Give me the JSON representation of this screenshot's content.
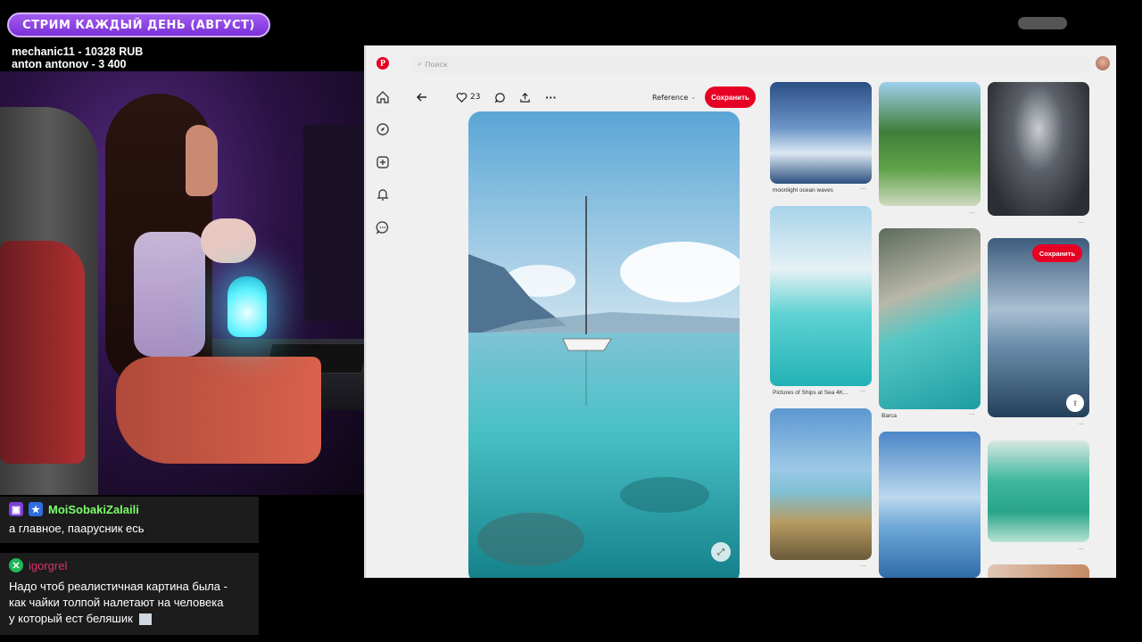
{
  "overlay": {
    "stream_title": "СТРИМ КАЖДЫЙ ДЕНЬ (АВГУСТ)",
    "donors": [
      "mechanic11 - 10328 RUB",
      "anton antonov - 3 400"
    ]
  },
  "chat": [
    {
      "user": "MoiSobakiZalaili",
      "user_color": "#7cff6a",
      "text": "а главное, паарусник есь"
    },
    {
      "user": "igorgrel",
      "user_color": "#e0306a",
      "text_lines": [
        "Надо чтоб реалистичная картина была -",
        "как чайки толпой налетают на человека",
        "у который ест беляшик"
      ]
    }
  ],
  "pinterest": {
    "logo": "P",
    "search_placeholder": "Поиск",
    "likes_count": "23",
    "board_select": "Reference",
    "save_label": "Сохранить",
    "pins": [
      {
        "caption": "moonlight ocean waves"
      },
      {
        "caption": "Pictures of Ships at Sea 4K..."
      },
      {
        "caption": "Barca"
      }
    ],
    "icons": {
      "back": "arrow-left-icon",
      "like": "heart-icon",
      "comment": "comment-icon",
      "share": "share-icon",
      "more": "more-icon"
    }
  },
  "colors": {
    "accent": "#e60023",
    "overlay_purple": "#8a44e4"
  }
}
